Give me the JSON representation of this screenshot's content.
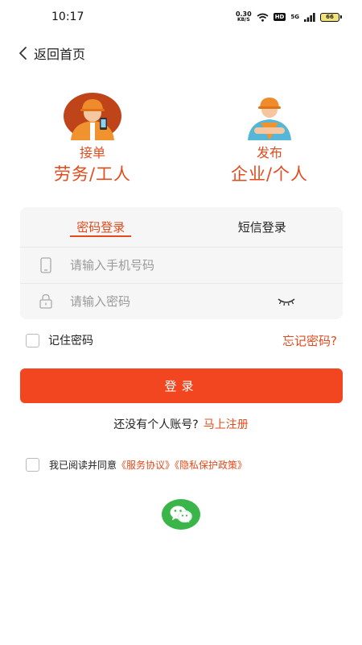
{
  "status_bar": {
    "time": "10:17",
    "net_speed_value": "0.30",
    "net_speed_unit": "KB/S",
    "hd_label": "HD",
    "network_label": "5G",
    "battery_level": "66"
  },
  "header": {
    "back_label": "返回首页"
  },
  "roles": [
    {
      "title": "接单",
      "subtitle": "劳务/工人",
      "icon": "worker-with-phone-icon"
    },
    {
      "title": "发布",
      "subtitle": "企业/个人",
      "icon": "worker-arms-crossed-icon"
    }
  ],
  "login": {
    "tabs": [
      {
        "label": "密码登录",
        "active": true
      },
      {
        "label": "短信登录",
        "active": false
      }
    ],
    "phone_placeholder": "请输入手机号码",
    "password_placeholder": "请输入密码",
    "remember_label": "记住密码",
    "forgot_label": "忘记密码?",
    "submit_label": "登录"
  },
  "register": {
    "prompt": "还没有个人账号?",
    "link": "马上注册"
  },
  "agreement": {
    "text": "我已阅读并同意",
    "service_link": "《服务协议》",
    "privacy_link": "《隐私保护政策》"
  },
  "social": {
    "wechat_icon": "wechat-icon"
  },
  "colors": {
    "accent": "#e34a1c",
    "button": "#f1461f",
    "wechat": "#39b54a"
  }
}
